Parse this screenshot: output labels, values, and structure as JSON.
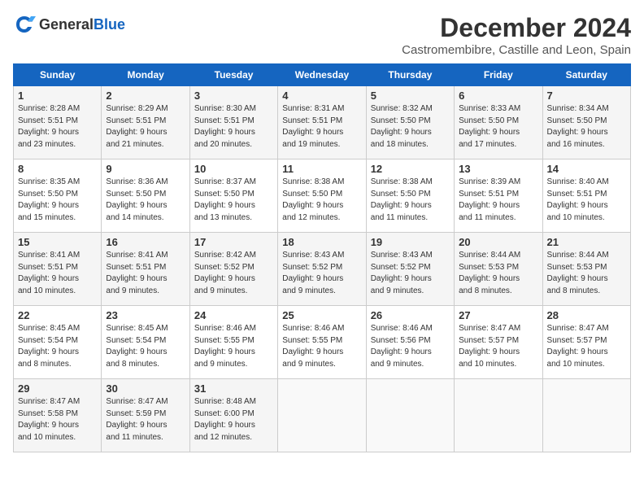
{
  "header": {
    "logo_general": "General",
    "logo_blue": "Blue",
    "month_year": "December 2024",
    "location": "Castromembibre, Castille and Leon, Spain"
  },
  "weekdays": [
    "Sunday",
    "Monday",
    "Tuesday",
    "Wednesday",
    "Thursday",
    "Friday",
    "Saturday"
  ],
  "weeks": [
    [
      {
        "day": "1",
        "info": "Sunrise: 8:28 AM\nSunset: 5:51 PM\nDaylight: 9 hours\nand 23 minutes."
      },
      {
        "day": "2",
        "info": "Sunrise: 8:29 AM\nSunset: 5:51 PM\nDaylight: 9 hours\nand 21 minutes."
      },
      {
        "day": "3",
        "info": "Sunrise: 8:30 AM\nSunset: 5:51 PM\nDaylight: 9 hours\nand 20 minutes."
      },
      {
        "day": "4",
        "info": "Sunrise: 8:31 AM\nSunset: 5:51 PM\nDaylight: 9 hours\nand 19 minutes."
      },
      {
        "day": "5",
        "info": "Sunrise: 8:32 AM\nSunset: 5:50 PM\nDaylight: 9 hours\nand 18 minutes."
      },
      {
        "day": "6",
        "info": "Sunrise: 8:33 AM\nSunset: 5:50 PM\nDaylight: 9 hours\nand 17 minutes."
      },
      {
        "day": "7",
        "info": "Sunrise: 8:34 AM\nSunset: 5:50 PM\nDaylight: 9 hours\nand 16 minutes."
      }
    ],
    [
      {
        "day": "8",
        "info": "Sunrise: 8:35 AM\nSunset: 5:50 PM\nDaylight: 9 hours\nand 15 minutes."
      },
      {
        "day": "9",
        "info": "Sunrise: 8:36 AM\nSunset: 5:50 PM\nDaylight: 9 hours\nand 14 minutes."
      },
      {
        "day": "10",
        "info": "Sunrise: 8:37 AM\nSunset: 5:50 PM\nDaylight: 9 hours\nand 13 minutes."
      },
      {
        "day": "11",
        "info": "Sunrise: 8:38 AM\nSunset: 5:50 PM\nDaylight: 9 hours\nand 12 minutes."
      },
      {
        "day": "12",
        "info": "Sunrise: 8:38 AM\nSunset: 5:50 PM\nDaylight: 9 hours\nand 11 minutes."
      },
      {
        "day": "13",
        "info": "Sunrise: 8:39 AM\nSunset: 5:51 PM\nDaylight: 9 hours\nand 11 minutes."
      },
      {
        "day": "14",
        "info": "Sunrise: 8:40 AM\nSunset: 5:51 PM\nDaylight: 9 hours\nand 10 minutes."
      }
    ],
    [
      {
        "day": "15",
        "info": "Sunrise: 8:41 AM\nSunset: 5:51 PM\nDaylight: 9 hours\nand 10 minutes."
      },
      {
        "day": "16",
        "info": "Sunrise: 8:41 AM\nSunset: 5:51 PM\nDaylight: 9 hours\nand 9 minutes."
      },
      {
        "day": "17",
        "info": "Sunrise: 8:42 AM\nSunset: 5:52 PM\nDaylight: 9 hours\nand 9 minutes."
      },
      {
        "day": "18",
        "info": "Sunrise: 8:43 AM\nSunset: 5:52 PM\nDaylight: 9 hours\nand 9 minutes."
      },
      {
        "day": "19",
        "info": "Sunrise: 8:43 AM\nSunset: 5:52 PM\nDaylight: 9 hours\nand 9 minutes."
      },
      {
        "day": "20",
        "info": "Sunrise: 8:44 AM\nSunset: 5:53 PM\nDaylight: 9 hours\nand 8 minutes."
      },
      {
        "day": "21",
        "info": "Sunrise: 8:44 AM\nSunset: 5:53 PM\nDaylight: 9 hours\nand 8 minutes."
      }
    ],
    [
      {
        "day": "22",
        "info": "Sunrise: 8:45 AM\nSunset: 5:54 PM\nDaylight: 9 hours\nand 8 minutes."
      },
      {
        "day": "23",
        "info": "Sunrise: 8:45 AM\nSunset: 5:54 PM\nDaylight: 9 hours\nand 8 minutes."
      },
      {
        "day": "24",
        "info": "Sunrise: 8:46 AM\nSunset: 5:55 PM\nDaylight: 9 hours\nand 9 minutes."
      },
      {
        "day": "25",
        "info": "Sunrise: 8:46 AM\nSunset: 5:55 PM\nDaylight: 9 hours\nand 9 minutes."
      },
      {
        "day": "26",
        "info": "Sunrise: 8:46 AM\nSunset: 5:56 PM\nDaylight: 9 hours\nand 9 minutes."
      },
      {
        "day": "27",
        "info": "Sunrise: 8:47 AM\nSunset: 5:57 PM\nDaylight: 9 hours\nand 10 minutes."
      },
      {
        "day": "28",
        "info": "Sunrise: 8:47 AM\nSunset: 5:57 PM\nDaylight: 9 hours\nand 10 minutes."
      }
    ],
    [
      {
        "day": "29",
        "info": "Sunrise: 8:47 AM\nSunset: 5:58 PM\nDaylight: 9 hours\nand 10 minutes."
      },
      {
        "day": "30",
        "info": "Sunrise: 8:47 AM\nSunset: 5:59 PM\nDaylight: 9 hours\nand 11 minutes."
      },
      {
        "day": "31",
        "info": "Sunrise: 8:48 AM\nSunset: 6:00 PM\nDaylight: 9 hours\nand 12 minutes."
      },
      null,
      null,
      null,
      null
    ]
  ]
}
